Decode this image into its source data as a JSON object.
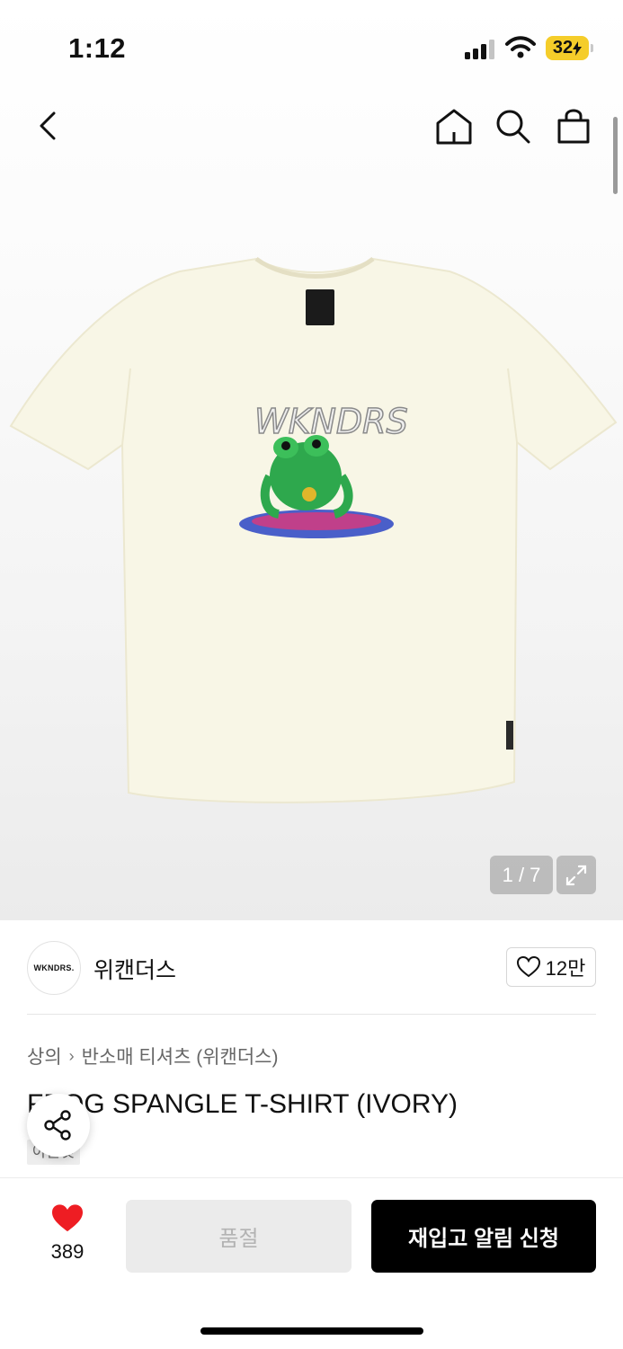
{
  "status_bar": {
    "time": "1:12",
    "battery": "32"
  },
  "gallery": {
    "image_alt": "Ivory short-sleeve t-shirt with sequined frog graphic",
    "counter": "1 / 7",
    "print_text": "WKNDRS"
  },
  "brand": {
    "logo_text": "WKNDRS.",
    "name": "위캔더스",
    "likes": "12만"
  },
  "breadcrumb": {
    "category": "상의",
    "sub": "반소매 티셔츠 (위캔더스)"
  },
  "product": {
    "title": "FROG SPANGLE T-SHIRT (IVORY)",
    "tag": "아울렛"
  },
  "bottom": {
    "wish_count": "389",
    "soldout_label": "품절",
    "restock_label": "재입고 알림 신청"
  },
  "colors": {
    "accent_red": "#ee1d23",
    "primary_black": "#000000",
    "tshirt_ivory": "#f8f6e6"
  }
}
